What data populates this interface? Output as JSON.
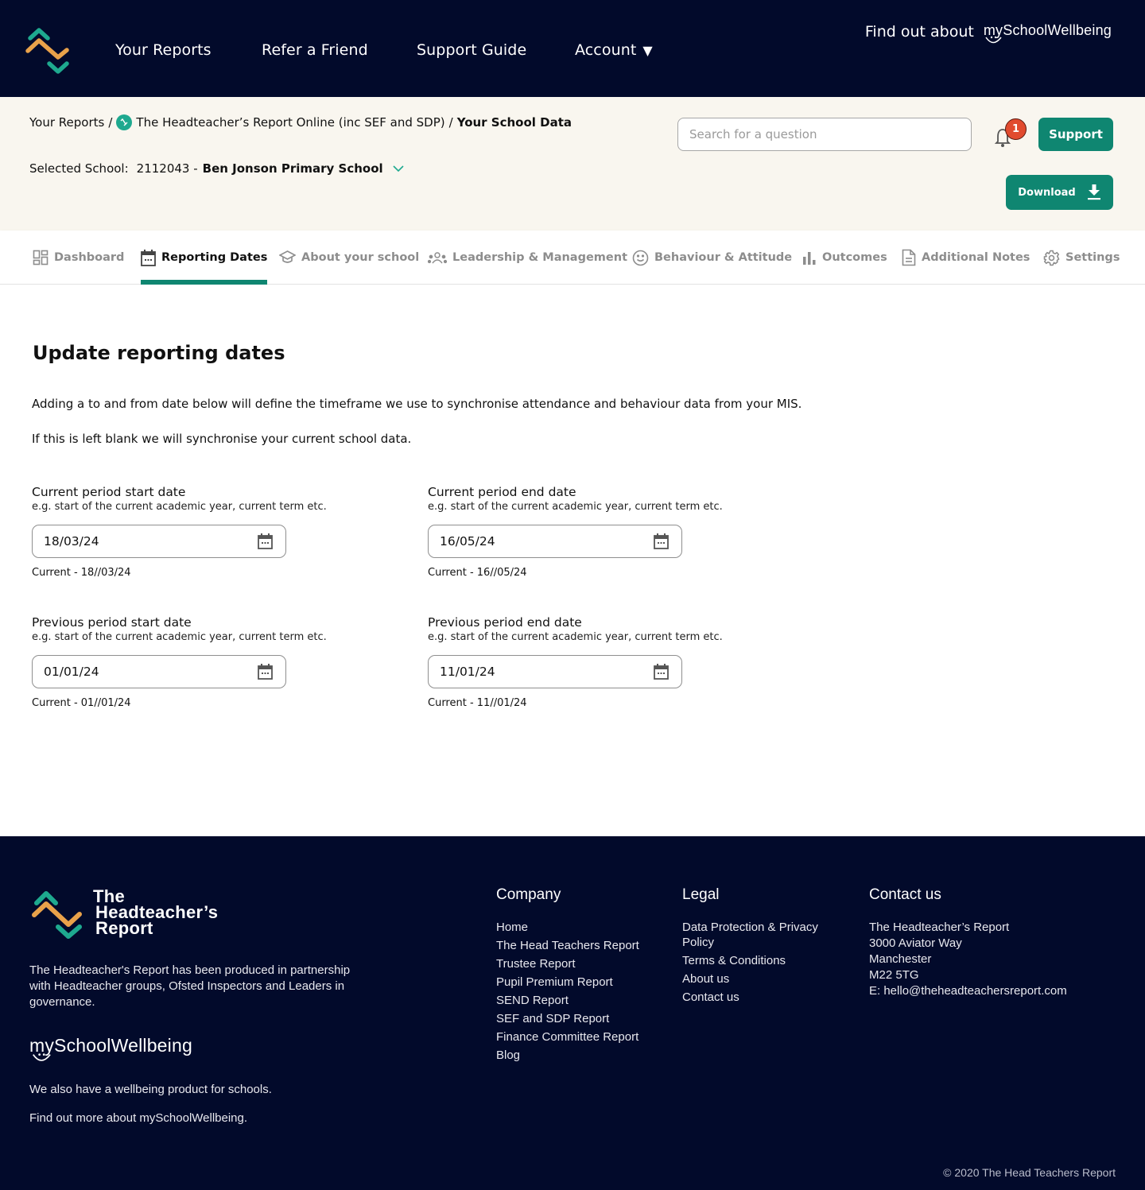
{
  "topnav": {
    "logo_alt": "The Headteacher's Report logo",
    "links": [
      "Your Reports",
      "Refer a Friend",
      "Support Guide",
      "Account"
    ],
    "account_caret": "▼",
    "findout_text": "Find out about",
    "msw_logo_text": "mySchoolWellbeing"
  },
  "subheader": {
    "breadcrumb": {
      "root": "Your Reports",
      "sep": "/",
      "report": "The Headteacher’s Report Online (inc SEF and SDP)",
      "current": "Your School Data"
    },
    "selected_school": {
      "label": "Selected School:",
      "code": "2112043 -",
      "name": "Ben Jonson Primary School"
    },
    "search_placeholder": "Search for a question",
    "search_value": "",
    "notification_count": "1",
    "support_label": "Support",
    "download_label": "Download"
  },
  "tabs": [
    {
      "label": "Dashboard",
      "icon": "dashboard-icon",
      "active": false
    },
    {
      "label": "Reporting Dates",
      "icon": "calendar-icon",
      "active": true
    },
    {
      "label": "About your school",
      "icon": "graduation-cap-icon",
      "active": false
    },
    {
      "label": "Leadership & Management",
      "icon": "people-icon",
      "active": false
    },
    {
      "label": "Behaviour & Attitude",
      "icon": "smiley-icon",
      "active": false
    },
    {
      "label": "Outcomes",
      "icon": "bar-chart-icon",
      "active": false
    },
    {
      "label": "Additional Notes",
      "icon": "document-icon",
      "active": false
    },
    {
      "label": "Settings",
      "icon": "gear-icon",
      "active": false
    }
  ],
  "main": {
    "title": "Update reporting dates",
    "intro_1": "Adding a to and from date below will define the timeframe we use to synchronise attendance and behaviour data from your MIS.",
    "intro_2": "If this is left blank we will synchronise your current school data.",
    "fields": [
      {
        "label": "Current period start date",
        "hint": "e.g. start of the current academic year, current term etc.",
        "value": "18/03/24",
        "current": "Current - 18//03/24"
      },
      {
        "label": "Current period end date",
        "hint": "e.g. start of the current academic year, current term etc.",
        "value": "16/05/24",
        "current": "Current - 16//05/24"
      },
      {
        "label": "Previous period start date",
        "hint": "e.g. start of the current academic year, current term etc.",
        "value": "01/01/24",
        "current": "Current - 01//01/24"
      },
      {
        "label": "Previous period end date",
        "hint": "e.g. start of the current academic year, current term etc.",
        "value": "11/01/24",
        "current": "Current - 11//01/24"
      }
    ]
  },
  "footer": {
    "brand_lines": [
      "The",
      "Headteacher’s",
      "Report"
    ],
    "description": "The Headteacher's Report has been produced in partnership with Headteacher groups, Ofsted Inspectors and Leaders in governance.",
    "msw_logo_text": "mySchoolWellbeing",
    "also_text": "We also have a wellbeing product for schools.",
    "find_more_text": "Find out more about mySchoolWellbeing.",
    "company": {
      "heading": "Company",
      "links": [
        "Home",
        "The Head Teachers Report",
        "Trustee Report",
        "Pupil Premium Report",
        "SEND Report",
        "SEF and SDP Report",
        "Finance Committee Report",
        "Blog"
      ]
    },
    "legal": {
      "heading": "Legal",
      "links": [
        "Data Protection & Privacy Policy",
        "Terms & Conditions",
        "About us",
        "Contact us"
      ]
    },
    "contact": {
      "heading": "Contact us",
      "lines": [
        "The Headteacher’s Report",
        "3000 Aviator Way",
        "Manchester",
        "M22 5TG",
        "E: hello@theheadteachersreport.com"
      ]
    },
    "copyright": "© 2020 The Head Teachers Report"
  },
  "colors": {
    "navy": "#020a2b",
    "teal": "#1ea98f",
    "button_green": "#0f8671",
    "orange": "#e9a24a",
    "badge_red": "#e14b2f",
    "subheader_bg": "#f9f6ef"
  }
}
